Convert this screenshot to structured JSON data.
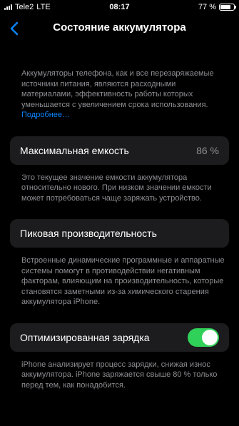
{
  "status_bar": {
    "carrier": "Tele2",
    "network": "LTE",
    "time": "08:17",
    "battery_percent": "77 %",
    "battery_level": 0.77
  },
  "nav": {
    "title": "Состояние аккумулятора",
    "back_icon": "chevron-left-icon"
  },
  "intro": {
    "text": "Аккумуляторы телефона, как и все перезаряжаемые источники питания, являются расходными материалами, эффективность работы которых уменьшается с увеличением срока использования. ",
    "link": "Подробнее…"
  },
  "max_capacity": {
    "label": "Максимальная емкость",
    "value": "86 %",
    "note": "Это текущее значение емкости аккумулятора относительно нового. При низком значении емкости может потребоваться чаще заряжать устройство."
  },
  "peak_performance": {
    "label": "Пиковая производительность",
    "note": "Встроенные динамические программные и аппаратные системы помогут в противодействии негативным факторам, влияющим на производительность, которые становятся заметными из-за химического старения аккумулятора iPhone."
  },
  "optimized_charging": {
    "label": "Оптимизированная зарядка",
    "enabled": true,
    "note": "iPhone анализирует процесс зарядки, снижая износ аккумулятора. iPhone заряжается свыше 80 % только перед тем, как понадобится."
  },
  "colors": {
    "background": "#000000",
    "card": "#1c1c1e",
    "secondary_text": "#8e8e93",
    "accent": "#0a84ff",
    "toggle_on": "#30d158"
  }
}
